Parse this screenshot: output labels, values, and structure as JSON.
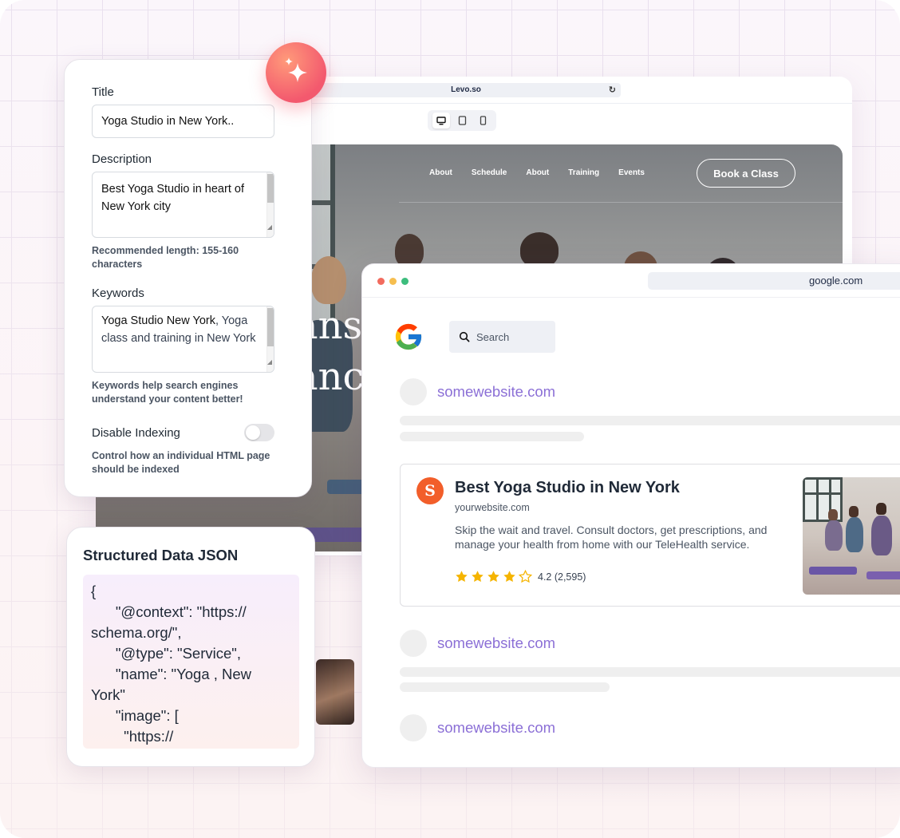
{
  "site_preview": {
    "url": "Levo.so",
    "nav": [
      "About",
      "Schedule",
      "About",
      "Training",
      "Events"
    ],
    "cta": "Book a Class",
    "hero_fragments": [
      "ans",
      "anc"
    ]
  },
  "seo_panel": {
    "title_label": "Title",
    "title_value": "Yoga Studio in New York..",
    "description_label": "Description",
    "description_value": "Best Yoga Studio in heart of New York city",
    "description_hint": "Recommended length: 155-160 characters",
    "keywords_label": "Keywords",
    "keywords_value_bold": "Yoga Studio New York",
    "keywords_value_rest": ", Yoga class and training in  New York",
    "keywords_hint": "Keywords help search engines understand your content better!",
    "indexing_label": "Disable Indexing",
    "indexing_enabled": false,
    "indexing_hint": "Control how an individual HTML page should be indexed"
  },
  "structured_data": {
    "title": "Structured Data JSON",
    "code": "{\n      \"@context\": \"https://\nschema.org/\",\n      \"@type\": \"Service\",\n      \"name\": \"Yoga , New\nYork\"\n      \"image\": [\n        \"https://"
  },
  "google": {
    "url": "google.com",
    "search_placeholder": "Search",
    "results": [
      "somewebsite.com",
      "somewebsite.com",
      "somewebsite.com"
    ],
    "featured": {
      "logo_letter": "S",
      "title": "Best Yoga Studio in New York",
      "url": "yourwebsite.com",
      "description": "Skip the wait and travel. Consult doctors, get prescriptions, and manage your health from home with our TeleHealth service.",
      "rating_text": "4.2 (2,595)",
      "rating": 4.2
    }
  },
  "colors": {
    "accent_purple": "#8b6fd6",
    "badge_gradient_start": "#ff9a7a",
    "badge_gradient_end": "#f3596e",
    "star": "#f5b400",
    "brand_logo": "#f25e2a"
  }
}
